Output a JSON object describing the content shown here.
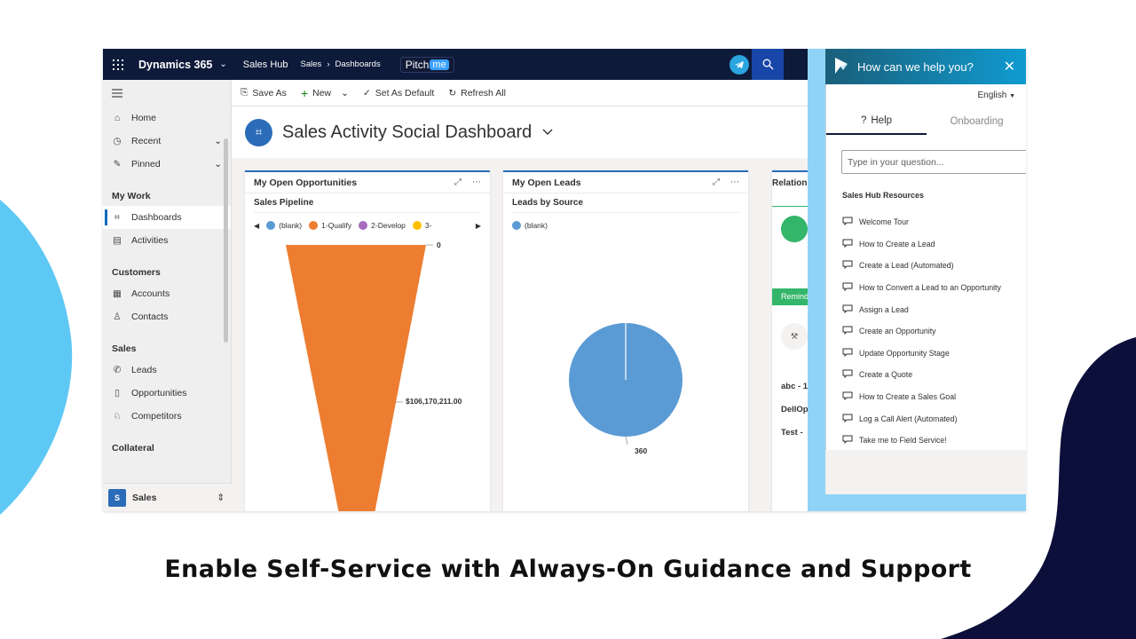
{
  "caption": "Enable Self-Service with Always-On Guidance and Support",
  "topbar": {
    "brand": "Dynamics 365",
    "app": "Sales Hub",
    "crumb_1": "Sales",
    "crumb_2": "Dashboards",
    "pitch": "Pitch",
    "pitch_me": "me"
  },
  "commandbar": {
    "save_as": "Save As",
    "new": "New",
    "set_default": "Set As Default",
    "refresh_all": "Refresh All"
  },
  "nav": {
    "home": "Home",
    "recent": "Recent",
    "pinned": "Pinned",
    "my_work": "My Work",
    "dashboards": "Dashboards",
    "activities": "Activities",
    "customers": "Customers",
    "accounts": "Accounts",
    "contacts": "Contacts",
    "sales": "Sales",
    "leads": "Leads",
    "opportunities": "Opportunities",
    "competitors": "Competitors",
    "collateral": "Collateral",
    "area_letter": "S",
    "area_name": "Sales"
  },
  "dashboard": {
    "title": "Sales Activity Social Dashboard"
  },
  "cards": {
    "opps": {
      "title": "My Open Opportunities",
      "subtitle": "Sales Pipeline",
      "legend": [
        "(blank)",
        "1-Qualify",
        "2-Develop",
        "3-"
      ],
      "legend_colors": [
        "#5b9bd5",
        "#ed7d31",
        "#a66bbe",
        "#ffc000"
      ],
      "top_label": "0",
      "mid_label": "$106,170,211.00"
    },
    "leads": {
      "title": "My Open Leads",
      "subtitle": "Leads by Source",
      "legend": [
        "(blank)"
      ],
      "legend_colors": [
        "#5b9bd5"
      ],
      "pie_label": "360"
    },
    "relations": {
      "title": "Relations",
      "remind": "Remind",
      "rows": [
        "abc - 1",
        "DellOp",
        "Test -"
      ]
    }
  },
  "chart_data": [
    {
      "type": "funnel",
      "title": "Sales Pipeline",
      "categories": [
        "(blank)",
        "1-Qualify",
        "2-Develop",
        "3-"
      ],
      "data_labels": [
        "0",
        "$106,170,211.00"
      ]
    },
    {
      "type": "pie",
      "title": "Leads by Source",
      "categories": [
        "(blank)"
      ],
      "values": [
        360
      ]
    }
  ],
  "help": {
    "header": "How can we help you?",
    "language": "English",
    "tab_help": "Help",
    "tab_onboarding": "Onboarding",
    "search_placeholder": "Type in your question...",
    "resources_title": "Sales Hub Resources",
    "resources": [
      "Welcome Tour",
      "How to Create a Lead",
      "Create a Lead (Automated)",
      "How to Convert a Lead to an Opportunity",
      "Assign a Lead",
      "Create an Opportunity",
      "Update Opportunity Stage",
      "Create a Quote",
      "How to Create a Sales Goal",
      "Log a Call Alert (Automated)",
      "Take me to Field Service!"
    ]
  },
  "colors": {
    "topbar": "#0e1a3a",
    "accent": "#2b6cb8",
    "funnel": "#ed7d31",
    "pie": "#5b9bd5",
    "help_band": "#8fd4f6",
    "blob_left": "#5ec8f5",
    "blob_right": "#0c0f3a"
  }
}
